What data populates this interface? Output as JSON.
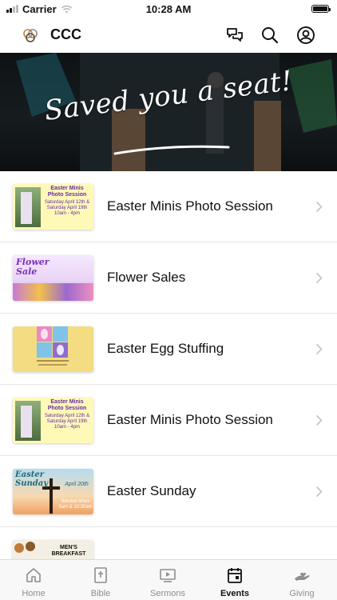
{
  "status_bar": {
    "carrier": "Carrier",
    "time": "10:28 AM"
  },
  "header": {
    "title": "CCC",
    "icons": [
      "logo-icon",
      "chat-icon",
      "search-icon",
      "profile-icon"
    ]
  },
  "hero": {
    "text": "Saved you a seat!"
  },
  "events": [
    {
      "title": "Easter Minis Photo Session",
      "thumb": {
        "lines": [
          "Easter Minis",
          "Photo Session",
          "Saturday April 12th &",
          "Saturday April 19th",
          "10am - 4pm"
        ]
      }
    },
    {
      "title": "Flower Sales",
      "thumb": {
        "lines": [
          "Flower Sale"
        ]
      }
    },
    {
      "title": "Easter Egg Stuffing",
      "thumb": {
        "lines": []
      }
    },
    {
      "title": "Easter Minis Photo Session",
      "thumb": {
        "lines": [
          "Easter Minis",
          "Photo Session",
          "Saturday April 12th &",
          "Saturday April 19th",
          "10am - 4pm"
        ]
      }
    },
    {
      "title": "Easter Sunday",
      "thumb": {
        "lines": [
          "Easter Sunday",
          "April 20th",
          "Service times",
          "9am & 10:30am"
        ]
      }
    },
    {
      "title": "",
      "thumb": {
        "lines": [
          "MEN'S",
          "BREAKFAST"
        ]
      }
    }
  ],
  "tabs": [
    {
      "label": "Home",
      "icon": "home-icon",
      "active": false
    },
    {
      "label": "Bible",
      "icon": "bible-icon",
      "active": false
    },
    {
      "label": "Sermons",
      "icon": "sermons-icon",
      "active": false
    },
    {
      "label": "Events",
      "icon": "events-icon",
      "active": true
    },
    {
      "label": "Giving",
      "icon": "giving-icon",
      "active": false
    }
  ],
  "colors": {
    "accent": "#111111",
    "tab_inactive": "#8e8e8e",
    "chevron": "#c4c4c4"
  }
}
